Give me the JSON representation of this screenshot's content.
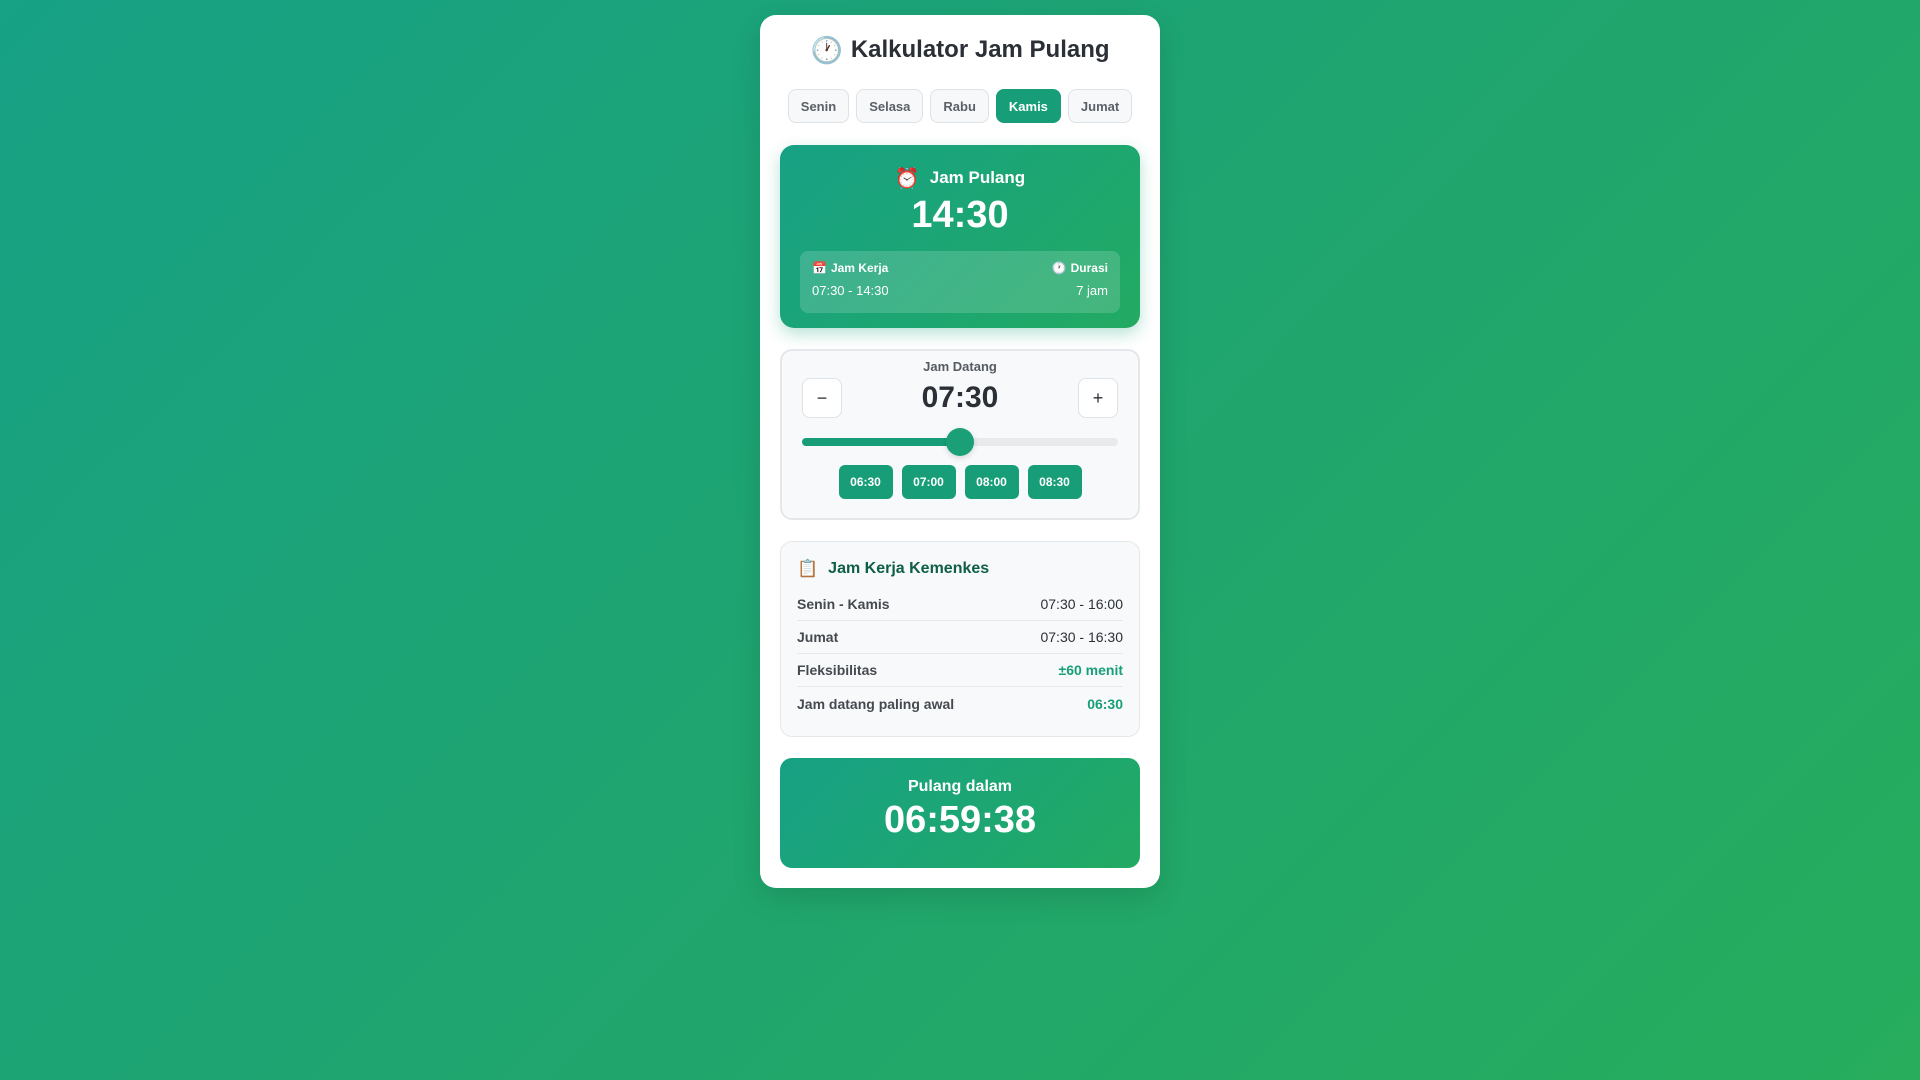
{
  "app": {
    "title": "Kalkulator Jam Pulang",
    "title_icon": "clock-icon"
  },
  "tabs": [
    {
      "label": "Senin",
      "active": false
    },
    {
      "label": "Selasa",
      "active": false
    },
    {
      "label": "Rabu",
      "active": false
    },
    {
      "label": "Kamis",
      "active": true
    },
    {
      "label": "Jumat",
      "active": false
    }
  ],
  "result": {
    "label": "Jam Pulang",
    "label_icon": "alarm-clock-icon",
    "time": "14:30",
    "work_hours_label": "Jam Kerja",
    "work_hours_icon": "calendar-icon",
    "work_hours_value": "07:30 - 14:30",
    "duration_label": "Durasi",
    "duration_icon": "clock-icon",
    "duration_value": "7 jam"
  },
  "arrival": {
    "label": "Jam Datang",
    "time": "07:30",
    "decrement_label": "−",
    "increment_label": "+",
    "slider_level": 0.5,
    "presets": [
      "06:30",
      "07:00",
      "08:00",
      "08:30"
    ]
  },
  "rules": {
    "title": "Jam Kerja Kemenkes",
    "title_icon": "clipboard-icon",
    "rows": [
      {
        "key": "Senin - Kamis",
        "value": "07:30 - 16:00",
        "accent": false
      },
      {
        "key": "Jumat",
        "value": "07:30 - 16:30",
        "accent": false
      },
      {
        "key": "Fleksibilitas",
        "value": "±60 menit",
        "accent": true
      },
      {
        "key": "Jam datang paling awal",
        "value": "06:30",
        "accent": true
      }
    ]
  },
  "countdown": {
    "label": "Pulang dalam",
    "time": "06:59:38"
  },
  "colors": {
    "accent": "#179e78",
    "accent_dark": "#0f5f44",
    "background_start": "#17a185",
    "background_end": "#27ad5c"
  }
}
